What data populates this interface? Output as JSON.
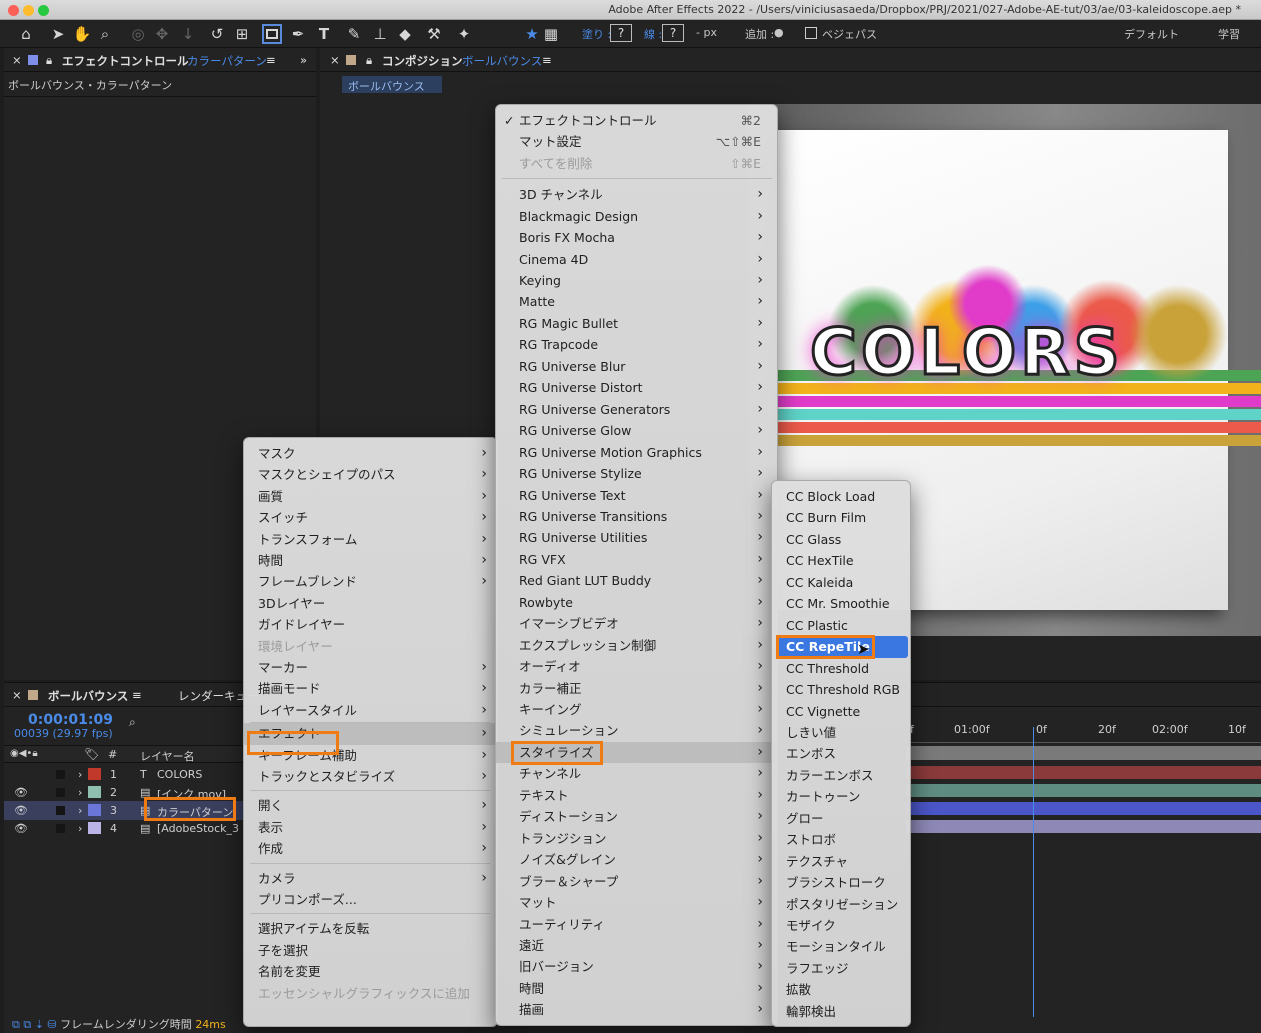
{
  "window": {
    "title": "Adobe After Effects 2022 - /Users/viniciusasaeda/Dropbox/PRJ/2021/027-Adobe-AE-tut/03/ae/03-kaleidoscope.aep *"
  },
  "toolbar": {
    "fill_label": "塗り :",
    "fill_value": "?",
    "stroke_label": "線 :",
    "stroke_value": "?",
    "px_label": "- px",
    "add_label": "追加 :",
    "bezier_label": "ベジェパス",
    "default_ws": "デフォルト",
    "learn_ws": "学習"
  },
  "effect_panel": {
    "tab_label": "エフェクトコントロール",
    "tab_layer": "カラーパターン",
    "breadcrumb": "ボールバウンス・カラーパターン"
  },
  "comp_panel": {
    "tab_label": "コンポジション",
    "tab_comp": "ボールバウンス",
    "comp_button": "ボールバウンス",
    "artwork_text": "COLORS"
  },
  "timeline": {
    "tab_label": "ボールバウンス",
    "render_tab": "レンダーキュー",
    "timecode": "0:00:01:09",
    "frame_info": "00039 (29.97 fps)",
    "column_layer_name": "レイヤー名",
    "ruler": [
      "f",
      "01:00f",
      "0f",
      "20f",
      "02:00f",
      "10f"
    ],
    "layers": [
      {
        "num": "1",
        "type": "T",
        "name": "COLORS",
        "color": "#c0392b"
      },
      {
        "num": "2",
        "type": "file",
        "name": "[インク.mov]",
        "color": "#8fbfaf"
      },
      {
        "num": "3",
        "type": "solid",
        "name": "カラーパターン",
        "color": "#6a76d8"
      },
      {
        "num": "4",
        "type": "file",
        "name": "[AdobeStock_3",
        "color": "#b9b3e6"
      }
    ],
    "footer_label": "フレームレンダリング時間",
    "footer_value": "24ms"
  },
  "context_menu": {
    "items": [
      {
        "label": "マスク",
        "submenu": true
      },
      {
        "label": "マスクとシェイプのパス",
        "submenu": true
      },
      {
        "label": "画質",
        "submenu": true
      },
      {
        "label": "スイッチ",
        "submenu": true
      },
      {
        "label": "トランスフォーム",
        "submenu": true
      },
      {
        "label": "時間",
        "submenu": true
      },
      {
        "label": "フレームブレンド",
        "submenu": true
      },
      {
        "label": "3Dレイヤー"
      },
      {
        "label": "ガイドレイヤー"
      },
      {
        "label": "環境レイヤー",
        "disabled": true
      },
      {
        "label": "マーカー",
        "submenu": true
      },
      {
        "label": "描画モード",
        "submenu": true
      },
      {
        "label": "レイヤースタイル",
        "submenu": true
      },
      {
        "label": "エフェクト",
        "submenu": true,
        "highlighted": true
      },
      {
        "label": "キーフレーム補助",
        "submenu": true
      },
      {
        "label": "トラックとスタビライズ",
        "submenu": true
      },
      {
        "label": "開く",
        "submenu": true
      },
      {
        "label": "表示",
        "submenu": true
      },
      {
        "label": "作成",
        "submenu": true
      },
      {
        "label": "カメラ",
        "submenu": true
      },
      {
        "label": "プリコンポーズ..."
      },
      {
        "label": "選択アイテムを反転"
      },
      {
        "label": "子を選択"
      },
      {
        "label": "名前を変更"
      },
      {
        "label": "エッセンシャルグラフィックスに追加",
        "disabled": true
      }
    ]
  },
  "effect_menu": {
    "top_items": [
      {
        "label": "エフェクトコントロール",
        "shortcut": "⌘2",
        "checked": true
      },
      {
        "label": "マット設定",
        "shortcut": "⌥⇧⌘E"
      },
      {
        "label": "すべてを削除",
        "shortcut": "⇧⌘E",
        "disabled": true
      }
    ],
    "check": "✓",
    "categories": [
      "3D チャンネル",
      "Blackmagic Design",
      "Boris FX Mocha",
      "Cinema 4D",
      "Keying",
      "Matte",
      "RG Magic Bullet",
      "RG Trapcode",
      "RG Universe Blur",
      "RG Universe Distort",
      "RG Universe Generators",
      "RG Universe Glow",
      "RG Universe Motion Graphics",
      "RG Universe Stylize",
      "RG Universe Text",
      "RG Universe Transitions",
      "RG Universe Utilities",
      "RG VFX",
      "Red Giant LUT Buddy",
      "Rowbyte",
      "イマーシブビデオ",
      "エクスプレッション制御",
      "オーディオ",
      "カラー補正",
      "キーイング",
      "シミュレーション",
      "スタイライズ",
      "チャンネル",
      "テキスト",
      "ディストーション",
      "トランジション",
      "ノイズ&グレイン",
      "ブラー＆シャープ",
      "マット",
      "ユーティリティ",
      "遠近",
      "旧バージョン",
      "時間",
      "描画"
    ],
    "highlighted": "スタイライズ"
  },
  "stylize_menu": {
    "items": [
      "CC Block Load",
      "CC Burn Film",
      "CC Glass",
      "CC HexTile",
      "CC Kaleida",
      "CC Mr. Smoothie",
      "CC Plastic",
      "CC RepeTile",
      "CC Threshold",
      "CC Threshold RGB",
      "CC Vignette",
      "しきい値",
      "エンボス",
      "カラーエンボス",
      "カートゥーン",
      "グロー",
      "ストロボ",
      "テクスチャ",
      "ブラシストローク",
      "ポスタリゼーション",
      "モザイク",
      "モーションタイル",
      "ラフエッジ",
      "拡散",
      "輪郭検出"
    ],
    "highlighted": "CC RepeTile"
  },
  "colors": {
    "accent_orange": "#f17b13",
    "highlight_blue": "#3b77e0",
    "timecode_blue": "#4a8be8"
  }
}
